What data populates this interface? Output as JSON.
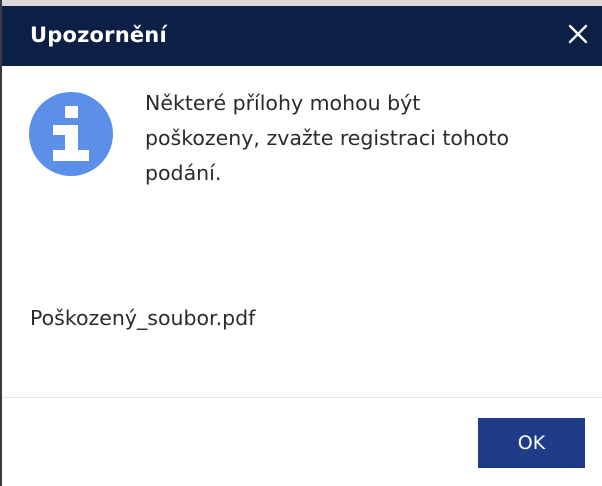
{
  "dialog": {
    "title": "Upozornění",
    "close_symbol": "×",
    "icon": "info-icon",
    "message_lines": [
      "Některé přílohy mohou být",
      "poškozeny, zvažte registraci tohoto",
      "podání."
    ],
    "attachment": "Poškozený_soubor.pdf",
    "ok_label": "OK"
  },
  "colors": {
    "titlebar": "#0c1f44",
    "button": "#1f3c88",
    "icon": "#5b8fe8",
    "text": "#2b2b2b"
  }
}
